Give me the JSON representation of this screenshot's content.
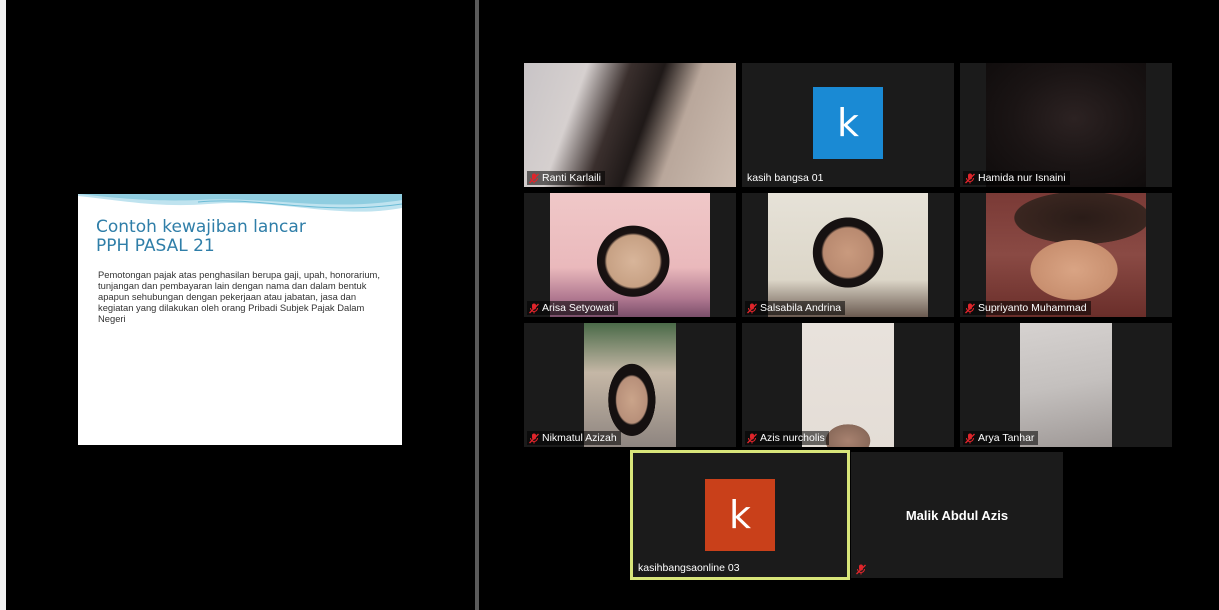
{
  "slide": {
    "title_line1": "Contoh kewajiban lancar",
    "title_line2": "PPH PASAL 21",
    "body": "Pemotongan pajak atas penghasilan berupa gaji, upah, honorarium, tunjangan dan pembayaran lain dengan nama dan dalam bentuk apapun sehubungan dengan pekerjaan atau jabatan, jasa dan kegiatan yang dilakukan oleh orang Pribadi Subjek Pajak Dalam Negeri"
  },
  "participants": [
    {
      "name": "Ranti Karlaili",
      "muted": true
    },
    {
      "name": "kasih bangsa 01",
      "muted": false,
      "avatar_letter": "k",
      "avatar_color": "#1a8ad4"
    },
    {
      "name": "Hamida nur Isnaini",
      "muted": true
    },
    {
      "name": "Arisa Setyowati",
      "muted": true
    },
    {
      "name": "Salsabila Andrina",
      "muted": true
    },
    {
      "name": "Supriyanto Muhammad",
      "muted": true
    },
    {
      "name": "Nikmatul Azizah",
      "muted": true
    },
    {
      "name": "Azis nurcholis",
      "muted": true
    },
    {
      "name": "Arya Tanhar",
      "muted": true
    },
    {
      "name": "kasihbangsaonline 03",
      "muted": false,
      "avatar_letter": "k",
      "avatar_color": "#c9401a",
      "active_speaker": true
    },
    {
      "name": "Malik Abdul Azis",
      "muted": true
    }
  ],
  "colors": {
    "muted_mic": "#e0252b",
    "active_border": "#d8e57a",
    "slide_title": "#2f7ea8"
  }
}
